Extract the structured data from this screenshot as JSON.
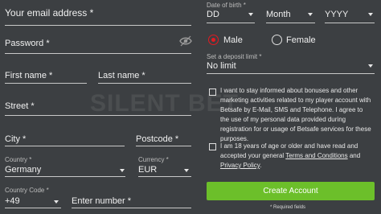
{
  "left": {
    "email_placeholder": "Your email address *",
    "password_placeholder": "Password *",
    "first_name_placeholder": "First name *",
    "last_name_placeholder": "Last name *",
    "street_placeholder": "Street *",
    "city_placeholder": "City *",
    "postcode_placeholder": "Postcode *",
    "country_label": "Country *",
    "country_value": "Germany",
    "currency_label": "Currency *",
    "currency_value": "EUR",
    "country_code_label": "Country Code *",
    "country_code_value": "+49",
    "number_placeholder": "Enter number *"
  },
  "right": {
    "dob_label": "Date of birth *",
    "dob_day": "DD",
    "dob_month": "Month",
    "dob_year": "YYYY",
    "gender_male": "Male",
    "gender_female": "Female",
    "gender_selected": "Male",
    "deposit_limit_label": "Set a deposit limit *",
    "deposit_limit_value": "No limit",
    "marketing_text": "I want to stay informed about bonuses and other marketing activities related to my player account with Betsafe by E-Mail, SMS and Telephone. I agree to the use of my personal data provided during registration for or usage of Betsafe services for these purposes.",
    "age_text_pre": "I am 18 years of age or older and have read and accepted your general",
    "terms_link": "Terms and Conditions",
    "and_text": "and",
    "privacy_link": "Privacy Policy",
    "period": ".",
    "create_button": "Create Account",
    "required_note": "* Required fields"
  },
  "watermark": "SILENT BET",
  "icons": {
    "password_toggle": "eye-icon",
    "dropdown": "chevron-down-icon"
  },
  "colors": {
    "background": "#3c3f42",
    "accent_green": "#6cbf2a",
    "radio_red": "#e11b22"
  }
}
